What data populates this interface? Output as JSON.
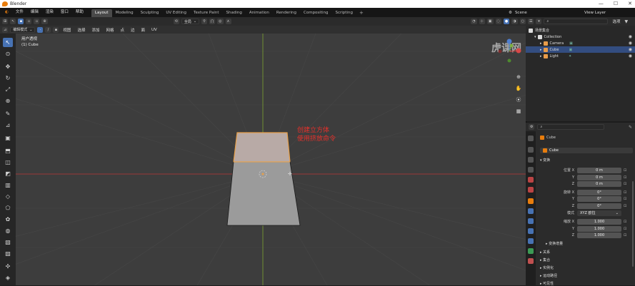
{
  "title_bar": {
    "app_title": "Blender",
    "min": "—",
    "max": "☐",
    "close": "✕"
  },
  "menus": [
    "文件",
    "编辑",
    "渲染",
    "窗口",
    "帮助"
  ],
  "workspaces": [
    "Layout",
    "Modeling",
    "Sculpting",
    "UV Editing",
    "Texture Paint",
    "Shading",
    "Animation",
    "Rendering",
    "Compositing",
    "Scripting"
  ],
  "add_tab": "+",
  "scene": {
    "label": "Scene"
  },
  "view_layer": {
    "label": "View Layer"
  },
  "viewport_header": {
    "mode": "编辑模式",
    "menus": [
      "视图",
      "选择",
      "添加",
      "网格",
      "点",
      "边",
      "面",
      "UV"
    ],
    "orientation": "全局",
    "snap_icon": "magnet-icon"
  },
  "viewport": {
    "view_name": "用户透视",
    "object_name": "(1) Cube",
    "annotation_line1": "创建立方体",
    "annotation_line2": "使用挤放命令",
    "watermark": "虎课网"
  },
  "outliner": {
    "header_menu": "选项",
    "root": "场景集合",
    "items": [
      {
        "label": "Collection",
        "icon_color": "#dcdcdc",
        "indent": 1
      },
      {
        "label": "Camera",
        "icon_color": "#e89c4a",
        "indent": 2
      },
      {
        "label": "Cube",
        "icon_color": "#e89c4a",
        "indent": 2,
        "selected": true
      },
      {
        "label": "Light",
        "icon_color": "#e89c4a",
        "indent": 2
      }
    ]
  },
  "properties": {
    "object": "Cube",
    "data_name": "Cube",
    "section_transform": "变换",
    "location_label": "位置 X",
    "rotation_label": "旋转 X",
    "scale_label": "缩放 X",
    "axis_y": "Y",
    "axis_z": "Z",
    "location": [
      "0 m",
      "0 m",
      "0 m"
    ],
    "rotation": [
      "0°",
      "0°",
      "0°"
    ],
    "mode_label": "模式",
    "mode_value": "XYZ 欧拉",
    "scale": [
      "1.000",
      "1.000",
      "1.000"
    ],
    "delta": "变换增量",
    "collapsed_sections": [
      "关系",
      "集合",
      "实例化",
      "运动路径",
      "可见性"
    ]
  },
  "colors": {
    "accent": "#4772b3",
    "red_axis": "#b43c3c",
    "green_axis": "#78a03c",
    "annotation": "#e8302a"
  }
}
